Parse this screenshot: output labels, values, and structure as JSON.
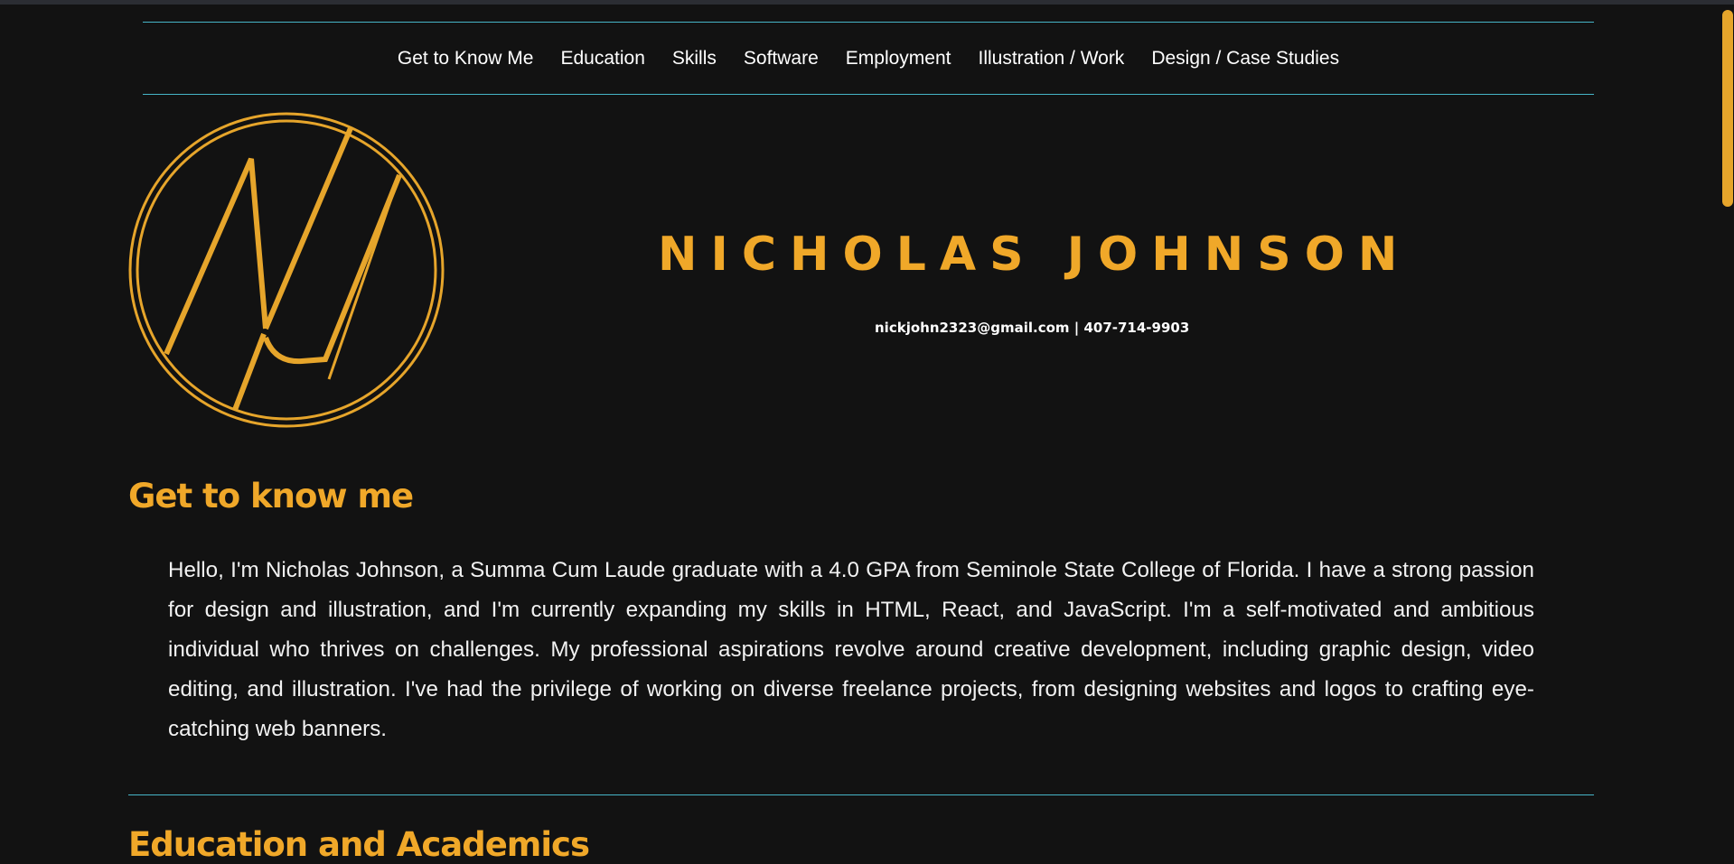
{
  "nav": {
    "items": [
      {
        "label": "Get to Know Me",
        "name": "nav-item-get-to-know-me"
      },
      {
        "label": "Education",
        "name": "nav-item-education"
      },
      {
        "label": "Skills",
        "name": "nav-item-skills"
      },
      {
        "label": "Software",
        "name": "nav-item-software"
      },
      {
        "label": "Employment",
        "name": "nav-item-employment"
      },
      {
        "label": "Illustration / Work",
        "name": "nav-item-illustration-work"
      },
      {
        "label": "Design / Case Studies",
        "name": "nav-item-design-case-studies"
      }
    ]
  },
  "hero": {
    "logo_icon": "nj-monogram-logo",
    "name": "NICHOLAS JOHNSON",
    "contact": "nickjohn2323@gmail.com | 407-714-9903"
  },
  "about": {
    "heading": "Get to know me",
    "body": "Hello, I'm Nicholas Johnson, a Summa Cum Laude graduate with a 4.0 GPA from Seminole State College of Florida. I have a strong passion for design and illustration, and I'm currently expanding my skills in HTML, React, and JavaScript. I'm a self-motivated and ambitious individual who thrives on challenges. My professional aspirations revolve around creative development, including graphic design, video editing, and illustration. I've had the privilege of working on diverse freelance projects, from designing websites and logos to crafting eye-catching web banners."
  },
  "education": {
    "heading": "Education and Academics"
  },
  "colors": {
    "background": "#121212",
    "accent": "#f0a829",
    "divider": "#46b5c8",
    "text": "#f2f2f2"
  }
}
